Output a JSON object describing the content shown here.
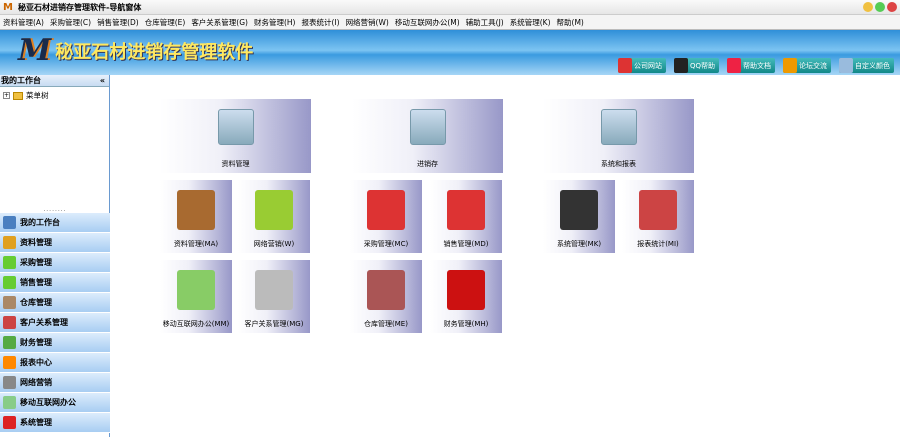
{
  "window": {
    "title": "秘亚石材进销存管理软件-导航窗体",
    "logo": "M"
  },
  "menu": [
    "资料管理(A)",
    "采购管理(C)",
    "销售管理(D)",
    "仓库管理(E)",
    "客户关系管理(G)",
    "财务管理(H)",
    "报表统计(I)",
    "网络营销(W)",
    "移动互联网办公(M)",
    "辅助工具(J)",
    "系统管理(K)",
    "帮助(M)"
  ],
  "banner": {
    "logo": "M",
    "name": "秘亚石材进销存管理软件"
  },
  "quick_links": [
    {
      "label": "公司网站",
      "color": "#d33"
    },
    {
      "label": "QQ帮助",
      "color": "#222"
    },
    {
      "label": "帮助文档",
      "color": "#e24"
    },
    {
      "label": "论坛交流",
      "color": "#e90"
    },
    {
      "label": "自定义颜色",
      "color": "#9bd"
    }
  ],
  "sidebar": {
    "title": "我的工作台",
    "collapse": "«",
    "tree_root": "菜单树",
    "splitter": "........",
    "nav": [
      {
        "label": "我的工作台",
        "color": "#4a7fc0"
      },
      {
        "label": "资料管理",
        "color": "#e0a020"
      },
      {
        "label": "采购管理",
        "color": "#6c3"
      },
      {
        "label": "销售管理",
        "color": "#6c3"
      },
      {
        "label": "仓库管理",
        "color": "#a86"
      },
      {
        "label": "客户关系管理",
        "color": "#c44"
      },
      {
        "label": "财务管理",
        "color": "#5a4"
      },
      {
        "label": "报表中心",
        "color": "#f80"
      },
      {
        "label": "网络营销",
        "color": "#888"
      },
      {
        "label": "移动互联网办公",
        "color": "#8c8"
      },
      {
        "label": "系统管理",
        "color": "#d22"
      }
    ]
  },
  "big_tiles": [
    {
      "label": "资料管理"
    },
    {
      "label": "进销存"
    },
    {
      "label": "系统和报表"
    }
  ],
  "small_tiles": [
    {
      "label": "资料管理(MA)",
      "color": "#a86a30"
    },
    {
      "label": "网络营销(W)",
      "color": "#9c3"
    },
    {
      "label": "采购管理(MC)",
      "color": "#d33"
    },
    {
      "label": "销售管理(MD)",
      "color": "#d33"
    },
    {
      "label": "系统管理(MK)",
      "color": "#333"
    },
    {
      "label": "报表统计(MI)",
      "color": "#c44"
    },
    {
      "label": "移动互联网办公(MM)",
      "color": "#8c6"
    },
    {
      "label": "客户关系管理(MG)",
      "color": "#bbb"
    },
    {
      "label": "仓库管理(ME)",
      "color": "#a55"
    },
    {
      "label": "财务管理(MH)",
      "color": "#c11"
    }
  ]
}
